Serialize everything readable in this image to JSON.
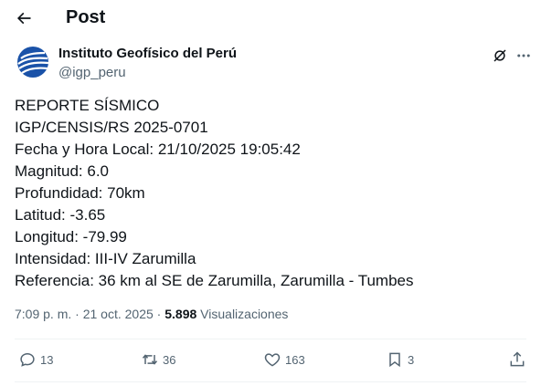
{
  "header": {
    "title": "Post"
  },
  "author": {
    "name": "Instituto Geofísico del Perú",
    "handle": "@igp_peru"
  },
  "tweet": {
    "lines": [
      "REPORTE SÍSMICO",
      "IGP/CENSIS/RS 2025-0701",
      "Fecha y Hora Local: 21/10/2025 19:05:42",
      "Magnitud: 6.0",
      "Profundidad: 70km",
      "Latitud: -3.65",
      "Longitud: -79.99",
      "Intensidad: III-IV Zarumilla",
      "Referencia: 36 km al SE de Zarumilla, Zarumilla - Tumbes"
    ]
  },
  "meta": {
    "time": "7:09 p. m.",
    "separator": "·",
    "date": "21 oct. 2025",
    "views_count": "5.898",
    "views_label": "Visualizaciones"
  },
  "actions": {
    "replies": "13",
    "reposts": "36",
    "likes": "163",
    "bookmarks": "3"
  },
  "icons": {
    "back": "arrow-left-icon",
    "grok": "grok-icon",
    "more": "more-horizontal-icon",
    "reply": "reply-icon",
    "repost": "repost-icon",
    "like": "heart-icon",
    "bookmark": "bookmark-icon",
    "share": "share-icon"
  },
  "colors": {
    "text": "#0f1419",
    "secondary": "#536471",
    "divider": "#eff3f4",
    "avatar_blue": "#1a52a8"
  }
}
